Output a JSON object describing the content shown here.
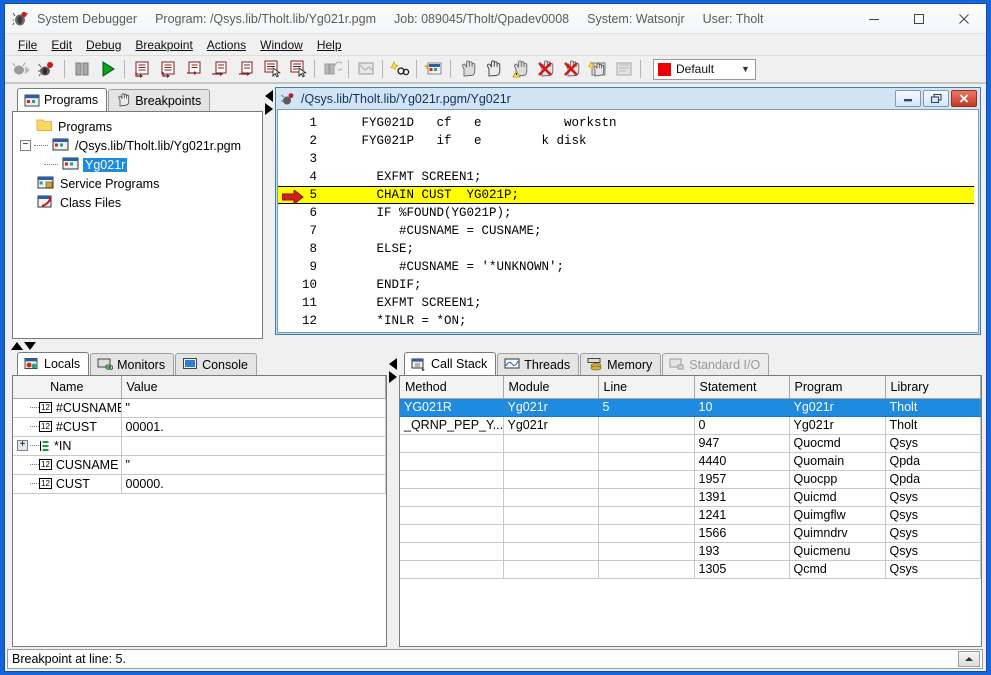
{
  "window": {
    "app_title": "System Debugger",
    "program_label": "Program: /Qsys.lib/Tholt.lib/Yg021r.pgm",
    "job_label": "Job: 089045/Tholt/Qpadev0008",
    "system_label": "System: Watsonjr",
    "user_label": "User: Tholt",
    "app_icon": "bug-icon",
    "minimize": "minimize-icon",
    "maximize": "maximize-icon",
    "close": "close-icon"
  },
  "menubar": {
    "items": [
      {
        "label": "File",
        "mnemonic": "F"
      },
      {
        "label": "Edit",
        "mnemonic": "E"
      },
      {
        "label": "Debug",
        "mnemonic": "D"
      },
      {
        "label": "Breakpoint",
        "mnemonic": "B"
      },
      {
        "label": "Actions",
        "mnemonic": "A"
      },
      {
        "label": "Window",
        "mnemonic": "W"
      },
      {
        "label": "Help",
        "mnemonic": "H"
      }
    ]
  },
  "toolbar": {
    "buttons": [
      {
        "name": "debug-run-icon",
        "enabled": false
      },
      {
        "name": "debug-bug-icon",
        "enabled": true
      },
      {
        "sep": true
      },
      {
        "name": "pause-icon",
        "enabled": true
      },
      {
        "name": "run-icon",
        "enabled": true
      },
      {
        "sep": true
      },
      {
        "name": "step-into-icon",
        "enabled": true
      },
      {
        "name": "step-over-icon",
        "enabled": true
      },
      {
        "name": "step-return-icon",
        "enabled": true
      },
      {
        "name": "step-out-icon",
        "enabled": true
      },
      {
        "name": "step-next-icon",
        "enabled": true
      },
      {
        "name": "run-to-cursor-icon",
        "enabled": true
      },
      {
        "name": "run-to-location-icon",
        "enabled": true
      },
      {
        "sep": true
      },
      {
        "name": "stop-icon",
        "enabled": false
      },
      {
        "sep": true
      },
      {
        "name": "new-monitor-icon",
        "enabled": false
      },
      {
        "sep": true
      },
      {
        "name": "add-breakpoint-icon",
        "enabled": true
      },
      {
        "sep": true
      },
      {
        "name": "watch-variable-icon",
        "enabled": true
      },
      {
        "sep": true
      },
      {
        "name": "breakpoint-set-icon",
        "enabled": true
      },
      {
        "name": "breakpoint-disabled-icon",
        "enabled": true
      },
      {
        "name": "breakpoint-conditional-icon",
        "enabled": true
      },
      {
        "name": "breakpoint-remove-icon",
        "enabled": true
      },
      {
        "name": "breakpoint-remove-all-icon",
        "enabled": true
      },
      {
        "name": "breakpoint-toggle-icon",
        "enabled": true
      },
      {
        "name": "breakpoint-list-icon",
        "enabled": false
      },
      {
        "sep": true
      }
    ],
    "view_select": {
      "value": "Default",
      "swatch_color": "#ee0000",
      "options": [
        "Default"
      ]
    }
  },
  "left_panel": {
    "tabs": [
      {
        "label": "Programs",
        "icon": "programs-icon",
        "active": true
      },
      {
        "label": "Breakpoints",
        "icon": "breakpoints-icon",
        "active": false
      }
    ],
    "tree": [
      {
        "label": "Programs",
        "icon": "folder-icon",
        "indent": 0,
        "expander": "",
        "selected": false
      },
      {
        "label": "/Qsys.lib/Tholt.lib/Yg021r.pgm",
        "icon": "program-icon",
        "indent": 1,
        "expander": "-",
        "selected": false
      },
      {
        "label": "Yg021r",
        "icon": "module-icon",
        "indent": 2,
        "expander": "",
        "selected": true
      },
      {
        "label": "Service Programs",
        "icon": "service-program-icon",
        "indent": 0,
        "expander": "",
        "selected": false
      },
      {
        "label": "Class Files",
        "icon": "class-file-icon",
        "indent": 0,
        "expander": "",
        "selected": false
      }
    ]
  },
  "editor": {
    "title": "/Qsys.lib/Tholt.lib/Yg021r.pgm/Yg021r",
    "icon": "bug-icon",
    "buttons": {
      "minimize": "minimize-icon",
      "restore": "restore-icon",
      "close": "close-icon"
    },
    "lines": [
      {
        "num": "1",
        "text": "     FYG021D   cf   e           workstn",
        "highlight": false,
        "marker": false
      },
      {
        "num": "2",
        "text": "     FYG021P   if   e        k disk",
        "highlight": false,
        "marker": false
      },
      {
        "num": "3",
        "text": "",
        "highlight": false,
        "marker": false
      },
      {
        "num": "4",
        "text": "       EXFMT SCREEN1;",
        "highlight": false,
        "marker": false
      },
      {
        "num": "5",
        "text": "       CHAIN CUST  YG021P;",
        "highlight": true,
        "marker": true
      },
      {
        "num": "6",
        "text": "       IF %FOUND(YG021P);",
        "highlight": false,
        "marker": false
      },
      {
        "num": "7",
        "text": "          #CUSNAME = CUSNAME;",
        "highlight": false,
        "marker": false
      },
      {
        "num": "8",
        "text": "       ELSE;",
        "highlight": false,
        "marker": false
      },
      {
        "num": "9",
        "text": "          #CUSNAME = '*UNKNOWN';",
        "highlight": false,
        "marker": false
      },
      {
        "num": "10",
        "text": "       ENDIF;",
        "highlight": false,
        "marker": false
      },
      {
        "num": "11",
        "text": "       EXFMT SCREEN1;",
        "highlight": false,
        "marker": false
      },
      {
        "num": "12",
        "text": "       *INLR = *ON;",
        "highlight": false,
        "marker": false
      }
    ]
  },
  "locals_panel": {
    "tabs": [
      {
        "label": "Locals",
        "icon": "locals-icon",
        "active": true,
        "enabled": true
      },
      {
        "label": "Monitors",
        "icon": "monitors-icon",
        "active": false,
        "enabled": true
      },
      {
        "label": "Console",
        "icon": "console-icon",
        "active": false,
        "enabled": true
      }
    ],
    "columns": [
      "Name",
      "Value"
    ],
    "rows": [
      {
        "name": "#CUSNAME",
        "value": "\"",
        "icon": "number-type-icon",
        "expandable": false
      },
      {
        "name": "#CUST",
        "value": "00001.",
        "icon": "number-type-icon",
        "expandable": false
      },
      {
        "name": "*IN",
        "value": "",
        "icon": "array-type-icon",
        "expandable": true
      },
      {
        "name": "CUSNAME",
        "value": "\"",
        "icon": "number-type-icon",
        "expandable": false
      },
      {
        "name": "CUST",
        "value": "00000.",
        "icon": "number-type-icon",
        "expandable": false
      }
    ]
  },
  "callstack_panel": {
    "tabs": [
      {
        "label": "Call Stack",
        "icon": "call-stack-icon",
        "active": true,
        "enabled": true
      },
      {
        "label": "Threads",
        "icon": "threads-icon",
        "active": false,
        "enabled": true
      },
      {
        "label": "Memory",
        "icon": "memory-icon",
        "active": false,
        "enabled": true
      },
      {
        "label": "Standard I/O",
        "icon": "standard-io-icon",
        "active": false,
        "enabled": false
      }
    ],
    "columns": [
      "Method",
      "Module",
      "Line",
      "Statement",
      "Program",
      "Library"
    ],
    "rows": [
      {
        "method": "YG021R",
        "module": "Yg021r",
        "line": "5",
        "statement": "10",
        "program": "Yg021r",
        "library": "Tholt",
        "selected": true
      },
      {
        "method": "_QRNP_PEP_Y...",
        "module": "Yg021r",
        "line": "",
        "statement": "0",
        "program": "Yg021r",
        "library": "Tholt",
        "selected": false
      },
      {
        "method": "",
        "module": "",
        "line": "",
        "statement": "947",
        "program": "Quocmd",
        "library": "Qsys",
        "selected": false
      },
      {
        "method": "",
        "module": "",
        "line": "",
        "statement": "4440",
        "program": "Quomain",
        "library": "Qpda",
        "selected": false
      },
      {
        "method": "",
        "module": "",
        "line": "",
        "statement": "1957",
        "program": "Quocpp",
        "library": "Qpda",
        "selected": false
      },
      {
        "method": "",
        "module": "",
        "line": "",
        "statement": "1391",
        "program": "Quicmd",
        "library": "Qsys",
        "selected": false
      },
      {
        "method": "",
        "module": "",
        "line": "",
        "statement": "1241",
        "program": "Quimgflw",
        "library": "Qsys",
        "selected": false
      },
      {
        "method": "",
        "module": "",
        "line": "",
        "statement": "1566",
        "program": "Quimndrv",
        "library": "Qsys",
        "selected": false
      },
      {
        "method": "",
        "module": "",
        "line": "",
        "statement": "193",
        "program": "Quicmenu",
        "library": "Qsys",
        "selected": false
      },
      {
        "method": "",
        "module": "",
        "line": "",
        "statement": "1305",
        "program": "Qcmd",
        "library": "Qsys",
        "selected": false
      }
    ]
  },
  "statusbar": {
    "message": "Breakpoint at line: 5."
  },
  "colors": {
    "desktop": "#1565d8",
    "selection": "#1e8ae0",
    "highlight_line": "#ffff00",
    "marker": "#d0201a",
    "accent_red": "#ee0000"
  }
}
